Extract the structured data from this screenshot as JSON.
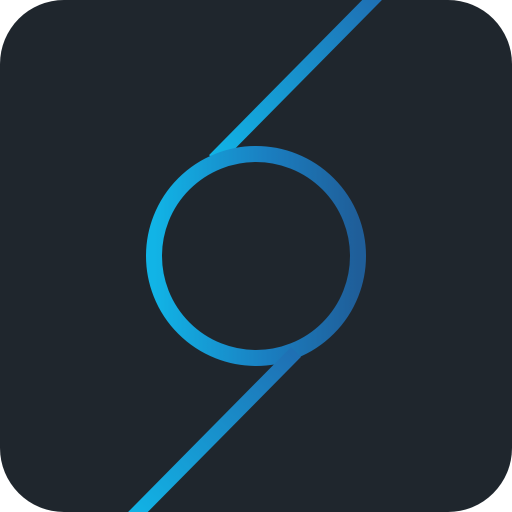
{
  "app_icon": {
    "name": "app-logo-icon",
    "background_color": "#1f262d",
    "stroke_gradient": [
      "#11b4e6",
      "#1a7fc1",
      "#1f5e99"
    ]
  }
}
